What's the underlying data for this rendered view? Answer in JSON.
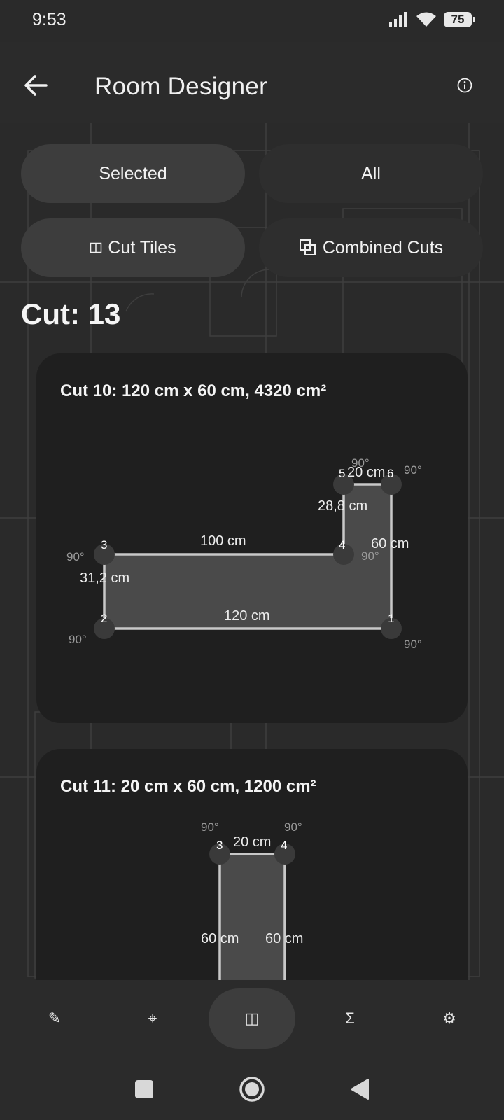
{
  "status_bar": {
    "time": "9:53",
    "battery": "75"
  },
  "app_bar": {
    "title": "Room Designer"
  },
  "filters": {
    "selected_label": "Selected",
    "all_label": "All",
    "cut_tiles_label": "Cut Tiles",
    "combined_cuts_label": "Combined Cuts"
  },
  "cut_heading": "Cut: 13",
  "cards": [
    {
      "title": "Cut 10: 120 cm x 60 cm, 4320 cm²",
      "edges": [
        "120 cm",
        "31,2 cm",
        "100 cm",
        "28,8 cm",
        "20 cm",
        "60 cm"
      ],
      "vertices": [
        "1",
        "2",
        "3",
        "4",
        "5",
        "6"
      ],
      "angles": [
        "90°",
        "90°",
        "90°",
        "90°",
        "90°",
        "90°"
      ]
    },
    {
      "title": "Cut 11: 20 cm x 60 cm, 1200 cm²",
      "edges": [
        "20 cm",
        "60 cm",
        "60 cm"
      ],
      "vertices": [
        "3",
        "4"
      ],
      "angles": [
        "90°",
        "90°"
      ]
    }
  ],
  "bottom_nav": {
    "items": [
      "pencil-icon",
      "crosshair-icon",
      "cut-tiles-icon",
      "sigma-icon",
      "settings-icon"
    ],
    "active_index": 2,
    "glyphs": [
      "✎",
      "⌖",
      "◫",
      "Σ",
      "⚙"
    ]
  },
  "colors": {
    "background": "#2b2b2b",
    "card": "#1f1f1f",
    "pill_active": "#3d3d3d",
    "shape_fill": "#4a4a4a",
    "shape_stroke": "#c8c8c8"
  }
}
